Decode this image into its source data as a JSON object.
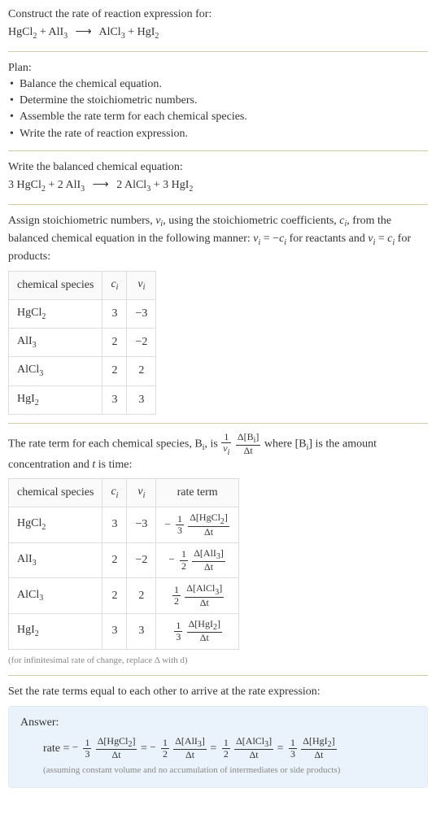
{
  "intro": {
    "prompt": "Construct the rate of reaction expression for:",
    "eq_lhs1": "HgCl",
    "eq_lhs1_sub": "2",
    "eq_plus1": " + ",
    "eq_lhs2": "AlI",
    "eq_lhs2_sub": "3",
    "eq_arrow": "⟶",
    "eq_rhs1": "AlCl",
    "eq_rhs1_sub": "3",
    "eq_plus2": " + ",
    "eq_rhs2": "HgI",
    "eq_rhs2_sub": "2"
  },
  "plan": {
    "heading": "Plan:",
    "bullets": [
      "Balance the chemical equation.",
      "Determine the stoichiometric numbers.",
      "Assemble the rate term for each chemical species.",
      "Write the rate of reaction expression."
    ],
    "bullet_dot": "•"
  },
  "balanced": {
    "heading": "Write the balanced chemical equation:",
    "c1": "3 ",
    "s1": "HgCl",
    "s1_sub": "2",
    "plus1": " + ",
    "c2": "2 ",
    "s2": "AlI",
    "s2_sub": "3",
    "arrow": "⟶",
    "c3": " 2 ",
    "s3": "AlCl",
    "s3_sub": "3",
    "plus2": " + ",
    "c4": "3 ",
    "s4": "HgI",
    "s4_sub": "2"
  },
  "assign": {
    "text1": "Assign stoichiometric numbers, ",
    "nu": "ν",
    "nu_sub": "i",
    "text2": ", using the stoichiometric coefficients, ",
    "c": "c",
    "c_sub": "i",
    "text3": ", from the balanced chemical equation in the following manner: ",
    "eq1_lhs": "ν",
    "eq1_lhs_sub": "i",
    "eq1_eq": " = −",
    "eq1_rhs": "c",
    "eq1_rhs_sub": "i",
    "text4": " for reactants and ",
    "eq2_lhs": "ν",
    "eq2_lhs_sub": "i",
    "eq2_eq": " = ",
    "eq2_rhs": "c",
    "eq2_rhs_sub": "i",
    "text5": " for products:"
  },
  "table1": {
    "h1": "chemical species",
    "h2": "c",
    "h2_sub": "i",
    "h3": "ν",
    "h3_sub": "i",
    "rows": [
      {
        "sp": "HgCl",
        "sp_sub": "2",
        "c": "3",
        "nu": "−3"
      },
      {
        "sp": "AlI",
        "sp_sub": "3",
        "c": "2",
        "nu": "−2"
      },
      {
        "sp": "AlCl",
        "sp_sub": "3",
        "c": "2",
        "nu": "2"
      },
      {
        "sp": "HgI",
        "sp_sub": "2",
        "c": "3",
        "nu": "3"
      }
    ]
  },
  "rate_intro": {
    "t1": "The rate term for each chemical species, B",
    "t1_sub": "i",
    "t2": ", is ",
    "frac1_num": "1",
    "frac1_den_a": "ν",
    "frac1_den_sub": "i",
    "frac2_num_a": "Δ[B",
    "frac2_num_sub": "i",
    "frac2_num_b": "]",
    "frac2_den": "Δt",
    "t3": " where [B",
    "t3_sub": "i",
    "t3b": "] is the amount concentration and ",
    "t4_ital": "t",
    "t5": " is time:"
  },
  "table2": {
    "h1": "chemical species",
    "h2": "c",
    "h2_sub": "i",
    "h3": "ν",
    "h3_sub": "i",
    "h4": "rate term",
    "rows": [
      {
        "sp": "HgCl",
        "sp_sub": "2",
        "c": "3",
        "nu": "−3",
        "neg": "−",
        "f1n": "1",
        "f1d": "3",
        "f2n_a": "Δ[HgCl",
        "f2n_sub": "2",
        "f2n_b": "]",
        "f2d": "Δt"
      },
      {
        "sp": "AlI",
        "sp_sub": "3",
        "c": "2",
        "nu": "−2",
        "neg": "−",
        "f1n": "1",
        "f1d": "2",
        "f2n_a": "Δ[AlI",
        "f2n_sub": "3",
        "f2n_b": "]",
        "f2d": "Δt"
      },
      {
        "sp": "AlCl",
        "sp_sub": "3",
        "c": "2",
        "nu": "2",
        "neg": "",
        "f1n": "1",
        "f1d": "2",
        "f2n_a": "Δ[AlCl",
        "f2n_sub": "3",
        "f2n_b": "]",
        "f2d": "Δt"
      },
      {
        "sp": "HgI",
        "sp_sub": "2",
        "c": "3",
        "nu": "3",
        "neg": "",
        "f1n": "1",
        "f1d": "3",
        "f2n_a": "Δ[HgI",
        "f2n_sub": "2",
        "f2n_b": "]",
        "f2d": "Δt"
      }
    ],
    "note": "(for infinitesimal rate of change, replace Δ with d)"
  },
  "setline": "Set the rate terms equal to each other to arrive at the rate expression:",
  "answer": {
    "title": "Answer:",
    "lead": "rate = ",
    "terms": [
      {
        "neg": "−",
        "f1n": "1",
        "f1d": "3",
        "f2n_a": "Δ[HgCl",
        "f2n_sub": "2",
        "f2n_b": "]",
        "f2d": "Δt",
        "sep": " = "
      },
      {
        "neg": "−",
        "f1n": "1",
        "f1d": "2",
        "f2n_a": "Δ[AlI",
        "f2n_sub": "3",
        "f2n_b": "]",
        "f2d": "Δt",
        "sep": " = "
      },
      {
        "neg": "",
        "f1n": "1",
        "f1d": "2",
        "f2n_a": "Δ[AlCl",
        "f2n_sub": "3",
        "f2n_b": "]",
        "f2d": "Δt",
        "sep": " = "
      },
      {
        "neg": "",
        "f1n": "1",
        "f1d": "3",
        "f2n_a": "Δ[HgI",
        "f2n_sub": "2",
        "f2n_b": "]",
        "f2d": "Δt",
        "sep": ""
      }
    ],
    "note": "(assuming constant volume and no accumulation of intermediates or side products)"
  }
}
